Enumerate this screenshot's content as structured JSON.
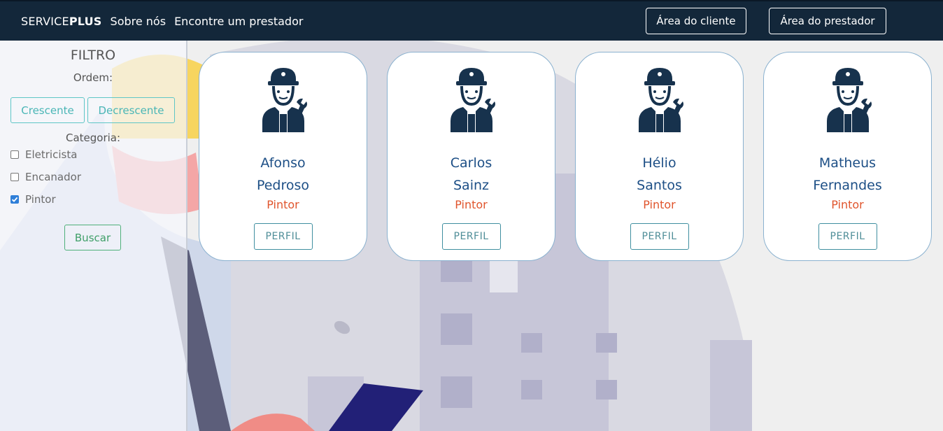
{
  "navbar": {
    "brand_prefix": "SERVICE",
    "brand_bold": "PLUS",
    "links": [
      "Sobre nós",
      "Encontre um prestador"
    ],
    "client_button": "Área do cliente",
    "provider_button": "Área do prestador"
  },
  "filter": {
    "title": "FILTRO",
    "order_label": "Ordem:",
    "ascending": "Crescente",
    "descending": "Decrescente",
    "category_label": "Categoria:",
    "categories": [
      {
        "label": "Eletricista",
        "checked": false
      },
      {
        "label": "Encanador",
        "checked": false
      },
      {
        "label": "Pintor",
        "checked": true
      }
    ],
    "search_button": "Buscar"
  },
  "providers": [
    {
      "first": "Afonso",
      "last": "Pedroso",
      "category": "Pintor",
      "button": "PERFIL"
    },
    {
      "first": "Carlos",
      "last": "Sainz",
      "category": "Pintor",
      "button": "PERFIL"
    },
    {
      "first": "Hélio",
      "last": "Santos",
      "category": "Pintor",
      "button": "PERFIL"
    },
    {
      "first": "Matheus",
      "last": "Fernandes",
      "category": "Pintor",
      "button": "PERFIL"
    }
  ],
  "colors": {
    "navbar": "#13273a",
    "name": "#1d4f86",
    "category": "#e0552d",
    "icon": "#17324d",
    "checkbox_checked": "#2f7fd8"
  },
  "icons": {
    "provider_avatar": "worker-with-wrench-icon",
    "checkbox": "checkbox-icon"
  }
}
